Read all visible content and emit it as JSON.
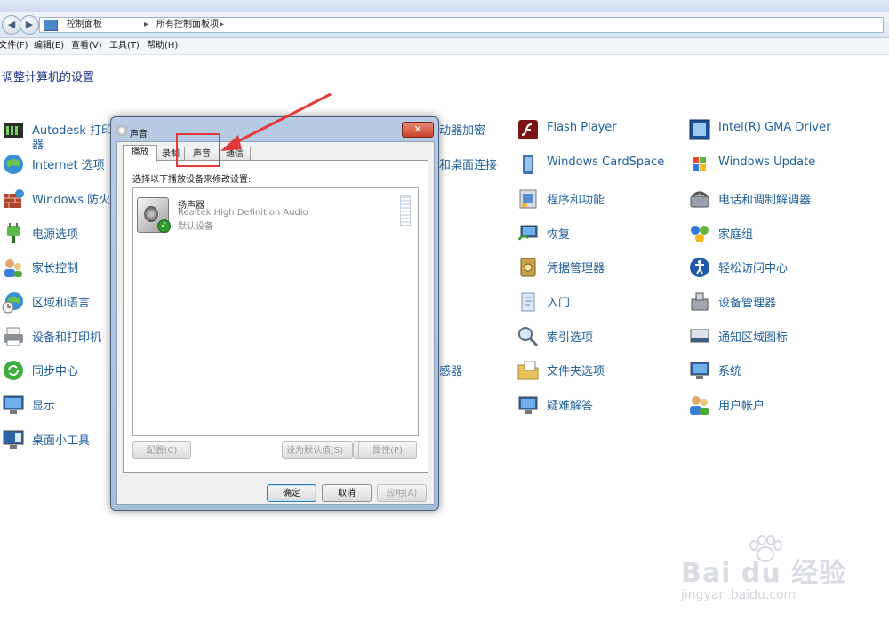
{
  "window": {
    "breadcrumb": [
      "控制面板",
      "所有控制面板项"
    ],
    "menu": [
      "文件(F)",
      "编辑(E)",
      "查看(V)",
      "工具(T)",
      "帮助(H)"
    ],
    "heading": "调整计算机的设置"
  },
  "control_panel_items": [
    {
      "label": "Autodesk 打印机",
      "label2": "器",
      "icon": "printer-manager-icon"
    },
    {
      "label": "Internet 选项",
      "icon": "globe-icon"
    },
    {
      "label": "Windows 防火墙",
      "icon": "firewall-icon"
    },
    {
      "label": "电源选项",
      "icon": "power-plug-icon"
    },
    {
      "label": "家长控制",
      "icon": "parental-control-icon"
    },
    {
      "label": "区域和语言",
      "icon": "clock-globe-icon"
    },
    {
      "label": "设备和打印机",
      "icon": "printer-icon"
    },
    {
      "label": "同步中心",
      "icon": "sync-icon"
    },
    {
      "label": "显示",
      "icon": "monitor-icon"
    },
    {
      "label": "桌面小工具",
      "icon": "gadgets-icon"
    },
    {
      "label": "动器加密",
      "icon": ""
    },
    {
      "label": "和桌面连接",
      "icon": ""
    },
    {
      "label": "感器",
      "icon": ""
    },
    {
      "label": "Flash Player",
      "icon": "flash-player-icon"
    },
    {
      "label": "Windows CardSpace",
      "icon": "cardspace-icon"
    },
    {
      "label": "程序和功能",
      "icon": "programs-icon"
    },
    {
      "label": "恢复",
      "icon": "recovery-icon"
    },
    {
      "label": "凭据管理器",
      "icon": "credential-vault-icon"
    },
    {
      "label": "入门",
      "icon": "getting-started-icon"
    },
    {
      "label": "索引选项",
      "icon": "magnifier-icon"
    },
    {
      "label": "文件夹选项",
      "icon": "folder-icon"
    },
    {
      "label": "疑难解答",
      "icon": "troubleshoot-icon"
    },
    {
      "label": "Intel(R) GMA Driver",
      "icon": "intel-gma-icon"
    },
    {
      "label": "Windows Update",
      "icon": "windows-update-icon"
    },
    {
      "label": "电话和调制解调器",
      "icon": "phone-modem-icon"
    },
    {
      "label": "家庭组",
      "icon": "homegroup-icon"
    },
    {
      "label": "轻松访问中心",
      "icon": "ease-of-access-icon"
    },
    {
      "label": "设备管理器",
      "icon": "device-manager-icon"
    },
    {
      "label": "通知区域图标",
      "icon": "notification-area-icon"
    },
    {
      "label": "系统",
      "icon": "system-icon"
    },
    {
      "label": "用户帐户",
      "icon": "user-accounts-icon"
    }
  ],
  "dialog": {
    "title": "声音",
    "close": "✕",
    "tabs": [
      "播放",
      "录制",
      "声音",
      "通信"
    ],
    "instruction": "选择以下播放设备来修改设置:",
    "device": {
      "name": "扬声器",
      "description": "Realtek High Definition Audio",
      "status": "默认设备"
    },
    "buttons": {
      "configure": "配置(C)",
      "set_default": "设为默认值(S)",
      "properties": "属性(P)",
      "ok": "确定",
      "cancel": "取消",
      "apply": "应用(A)"
    }
  },
  "watermark": {
    "brand": "Bai du 经验",
    "url": "jingyan.baidu.com"
  },
  "colors": {
    "link": "#1f5f9b",
    "annotation": "#e23a3a"
  }
}
